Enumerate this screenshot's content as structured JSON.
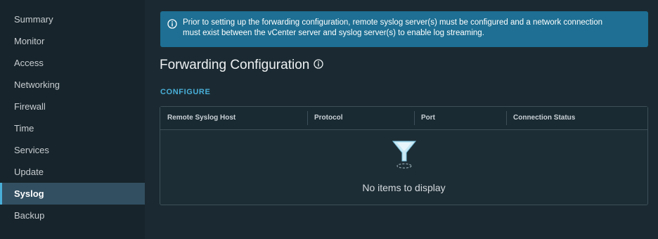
{
  "sidebar": {
    "items": [
      {
        "label": "Summary"
      },
      {
        "label": "Monitor"
      },
      {
        "label": "Access"
      },
      {
        "label": "Networking"
      },
      {
        "label": "Firewall"
      },
      {
        "label": "Time"
      },
      {
        "label": "Services"
      },
      {
        "label": "Update"
      },
      {
        "label": "Syslog",
        "active": true
      },
      {
        "label": "Backup"
      }
    ]
  },
  "alert": {
    "line1": "Prior to setting up the forwarding configuration, remote syslog server(s) must be configured and a network connection",
    "line2": "must exist between the vCenter server and syslog server(s) to enable log streaming.",
    "icon": "info-icon"
  },
  "main": {
    "title": "Forwarding Configuration",
    "title_icon": "info-icon",
    "configure_label": "CONFIGURE"
  },
  "grid": {
    "columns": [
      "Remote Syslog Host",
      "Protocol",
      "Port",
      "Connection Status"
    ],
    "rows": [],
    "empty_text": "No items to display",
    "empty_icon": "filter-funnel-icon"
  },
  "colors": {
    "accent": "#49afd9",
    "alert_bg": "#1e6f93",
    "active_nav": "#324f61"
  }
}
